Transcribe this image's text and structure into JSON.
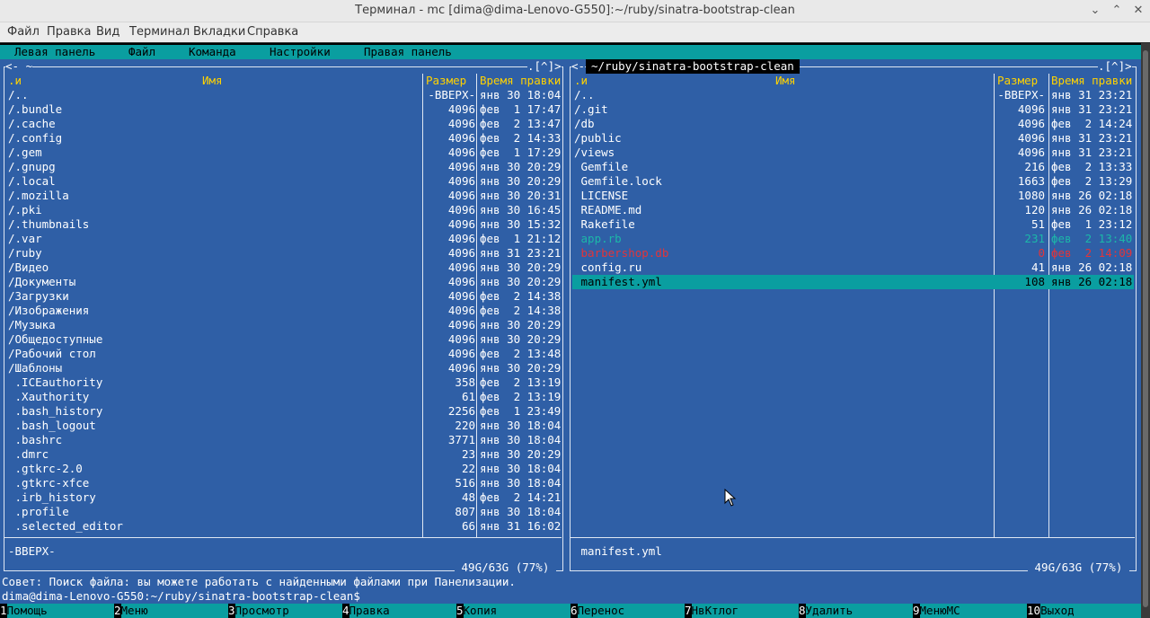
{
  "window": {
    "title": "Терминал - mc [dima@dima-Lenovo-G550]:~/ruby/sinatra-bootstrap-clean",
    "minimize": "⌃",
    "maximize": "⌃",
    "close": "✕"
  },
  "app_menu": [
    "Файл",
    "Правка",
    "Вид",
    "Терминал",
    "Вкладки",
    "Справка"
  ],
  "mc_menu": [
    "Левая панель",
    "Файл",
    "Команда",
    "Настройки",
    "Правая панель"
  ],
  "left_panel": {
    "top_left": "<- ~",
    "top_right": ".[^]>",
    "col_sort": ".и",
    "col_name": "Имя",
    "col_size": "Размер",
    "col_time": "Время правки",
    "rows": [
      {
        "name": "/..",
        "size": "-ВВЕРХ-",
        "time": "янв 30 18:04"
      },
      {
        "name": "/.bundle",
        "size": "4096",
        "time": "фев  1 17:47"
      },
      {
        "name": "/.cache",
        "size": "4096",
        "time": "фев  2 13:47"
      },
      {
        "name": "/.config",
        "size": "4096",
        "time": "фев  2 14:33"
      },
      {
        "name": "/.gem",
        "size": "4096",
        "time": "фев  1 17:29"
      },
      {
        "name": "/.gnupg",
        "size": "4096",
        "time": "янв 30 20:29"
      },
      {
        "name": "/.local",
        "size": "4096",
        "time": "янв 30 20:29"
      },
      {
        "name": "/.mozilla",
        "size": "4096",
        "time": "янв 30 20:31"
      },
      {
        "name": "/.pki",
        "size": "4096",
        "time": "янв 30 16:45"
      },
      {
        "name": "/.thumbnails",
        "size": "4096",
        "time": "янв 30 15:32"
      },
      {
        "name": "/.var",
        "size": "4096",
        "time": "фев  1 21:12"
      },
      {
        "name": "/ruby",
        "size": "4096",
        "time": "янв 31 23:21"
      },
      {
        "name": "/Видео",
        "size": "4096",
        "time": "янв 30 20:29"
      },
      {
        "name": "/Документы",
        "size": "4096",
        "time": "янв 30 20:29"
      },
      {
        "name": "/Загрузки",
        "size": "4096",
        "time": "фев  2 14:38"
      },
      {
        "name": "/Изображения",
        "size": "4096",
        "time": "фев  2 14:38"
      },
      {
        "name": "/Музыка",
        "size": "4096",
        "time": "янв 30 20:29"
      },
      {
        "name": "/Общедоступные",
        "size": "4096",
        "time": "янв 30 20:29"
      },
      {
        "name": "/Рабочий стол",
        "size": "4096",
        "time": "фев  2 13:48"
      },
      {
        "name": "/Шаблоны",
        "size": "4096",
        "time": "янв 30 20:29"
      },
      {
        "name": " .ICEauthority",
        "size": "358",
        "time": "фев  2 13:19"
      },
      {
        "name": " .Xauthority",
        "size": "61",
        "time": "фев  2 13:19"
      },
      {
        "name": " .bash_history",
        "size": "2256",
        "time": "фев  1 23:49"
      },
      {
        "name": " .bash_logout",
        "size": "220",
        "time": "янв 30 18:04"
      },
      {
        "name": " .bashrc",
        "size": "3771",
        "time": "янв 30 18:04"
      },
      {
        "name": " .dmrc",
        "size": "23",
        "time": "янв 30 20:29"
      },
      {
        "name": " .gtkrc-2.0",
        "size": "22",
        "time": "янв 30 18:04"
      },
      {
        "name": " .gtkrc-xfce",
        "size": "516",
        "time": "янв 30 18:04"
      },
      {
        "name": " .irb_history",
        "size": "48",
        "time": "фев  2 14:21"
      },
      {
        "name": " .profile",
        "size": "807",
        "time": "янв 30 18:04"
      },
      {
        "name": " .selected_editor",
        "size": "66",
        "time": "янв 31 16:02"
      }
    ],
    "status": "-ВВЕРХ-",
    "disk": " 49G/63G (77%) "
  },
  "right_panel": {
    "top_left": "<-",
    "path": "~/ruby/sinatra-bootstrap-clean",
    "top_right": ".[^]>",
    "col_sort": ".и",
    "col_name": "Имя",
    "col_size": "Размер",
    "col_time": "Время правки",
    "rows": [
      {
        "name": "/..",
        "size": "-ВВЕРХ-",
        "time": "янв 31 23:21",
        "kind": "dir"
      },
      {
        "name": "/.git",
        "size": "4096",
        "time": "янв 31 23:21",
        "kind": "dir"
      },
      {
        "name": "/db",
        "size": "4096",
        "time": "фев  2 14:24",
        "kind": "dir"
      },
      {
        "name": "/public",
        "size": "4096",
        "time": "янв 31 23:21",
        "kind": "dir"
      },
      {
        "name": "/views",
        "size": "4096",
        "time": "янв 31 23:21",
        "kind": "dir"
      },
      {
        "name": " Gemfile",
        "size": "216",
        "time": "фев  2 13:33",
        "kind": "file"
      },
      {
        "name": " Gemfile.lock",
        "size": "1663",
        "time": "фев  2 13:29",
        "kind": "file"
      },
      {
        "name": " LICENSE",
        "size": "1080",
        "time": "янв 26 02:18",
        "kind": "file"
      },
      {
        "name": " README.md",
        "size": "120",
        "time": "янв 26 02:18",
        "kind": "file"
      },
      {
        "name": " Rakefile",
        "size": "51",
        "time": "фев  1 23:12",
        "kind": "file"
      },
      {
        "name": " app.rb",
        "size": "231",
        "time": "фев  2 13:40",
        "kind": "exec"
      },
      {
        "name": " barbershop.db",
        "size": "0",
        "time": "фев  2 14:09",
        "kind": "db"
      },
      {
        "name": " config.ru",
        "size": "41",
        "time": "янв 26 02:18",
        "kind": "file"
      },
      {
        "name": " manifest.yml",
        "size": "108",
        "time": "янв 26 02:18",
        "kind": "selected"
      }
    ],
    "status": " manifest.yml",
    "disk": " 49G/63G (77%) "
  },
  "hint": "Совет: Поиск файла: вы можете работать с найденными файлами при Панелизации.",
  "prompt": "dima@dima-Lenovo-G550:~/ruby/sinatra-bootstrap-clean$",
  "fkeys": [
    {
      "num": "1",
      "label": "Помощь"
    },
    {
      "num": "2",
      "label": "Меню"
    },
    {
      "num": "3",
      "label": "Просмотр"
    },
    {
      "num": "4",
      "label": "Правка"
    },
    {
      "num": "5",
      "label": "Копия"
    },
    {
      "num": "6",
      "label": "Перенос"
    },
    {
      "num": "7",
      "label": "НвКтлог"
    },
    {
      "num": "8",
      "label": "Удалить"
    },
    {
      "num": "9",
      "label": "МенюMC"
    },
    {
      "num": "10",
      "label": "Выход"
    }
  ],
  "colors": {
    "panel_bg": "#2f5fa6",
    "menubar_bg": "#0a9ea0",
    "header_text": "#ffd200",
    "exec_file": "#1cb7a8",
    "db_file": "#e2343a"
  }
}
